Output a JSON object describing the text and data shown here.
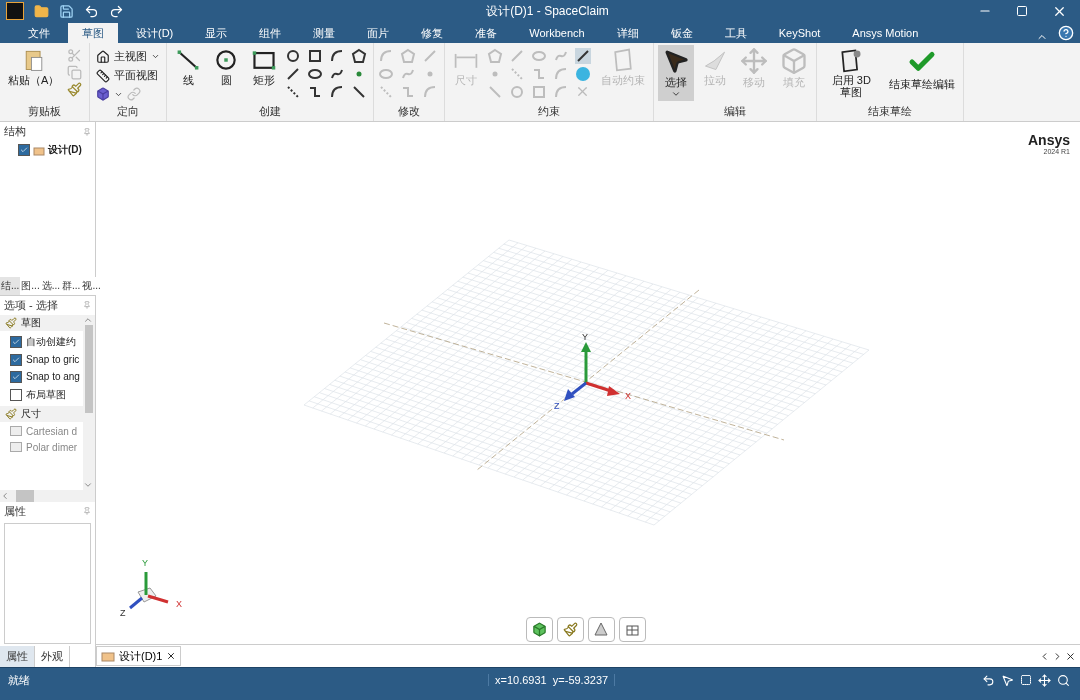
{
  "window": {
    "title": "设计(D)1 - SpaceClaim"
  },
  "ribbon_tabs": [
    {
      "label": "文件",
      "selected": false
    },
    {
      "label": "草图",
      "selected": true
    },
    {
      "label": "设计(D)",
      "selected": false
    },
    {
      "label": "显示",
      "selected": false
    },
    {
      "label": "组件",
      "selected": false
    },
    {
      "label": "测量",
      "selected": false
    },
    {
      "label": "面片",
      "selected": false
    },
    {
      "label": "修复",
      "selected": false
    },
    {
      "label": "准备",
      "selected": false
    },
    {
      "label": "Workbench",
      "selected": false
    },
    {
      "label": "详细",
      "selected": false
    },
    {
      "label": "钣金",
      "selected": false
    },
    {
      "label": "工具",
      "selected": false
    },
    {
      "label": "KeyShot",
      "selected": false
    },
    {
      "label": "Ansys Motion",
      "selected": false
    }
  ],
  "ribbon_groups": [
    {
      "kind": "clipboard",
      "label": "剪贴板",
      "buttons": [
        {
          "label": "粘贴（A）",
          "disabled": false
        }
      ]
    },
    {
      "kind": "orient",
      "label": "定向",
      "buttons": [
        {
          "label": "主视图"
        },
        {
          "label": "平面视图"
        }
      ]
    },
    {
      "kind": "create",
      "label": "创建",
      "buttons": [
        {
          "label": "线",
          "disabled": false
        },
        {
          "label": "圆",
          "disabled": false
        },
        {
          "label": "矩形",
          "disabled": false
        }
      ]
    },
    {
      "kind": "modify",
      "label": "修改"
    },
    {
      "kind": "constraint",
      "label": "约束",
      "buttons": [
        {
          "label": "尺寸",
          "disabled": true
        },
        {
          "label": "自动约束",
          "disabled": true
        }
      ]
    },
    {
      "kind": "edit",
      "label": "编辑",
      "buttons": [
        {
          "label": "选择",
          "disabled": false,
          "selected": true
        },
        {
          "label": "拉动",
          "disabled": true,
          "selected": false
        },
        {
          "label": "移动",
          "disabled": true,
          "selected": false
        },
        {
          "label": "填充",
          "disabled": true,
          "selected": false
        }
      ]
    },
    {
      "kind": "finish",
      "label": "结束草绘",
      "buttons": [
        {
          "label": "启用 3D 草图",
          "disabled": false
        },
        {
          "label": "结束草绘编辑",
          "disabled": false
        }
      ]
    }
  ],
  "structure_panel": {
    "title": "结构",
    "tree": [
      {
        "label": "设计(D)",
        "checked": true
      }
    ]
  },
  "panel_tabs": [
    {
      "label": "结...",
      "selected": true
    },
    {
      "label": "图...",
      "selected": false
    },
    {
      "label": "选...",
      "selected": false
    },
    {
      "label": "群...",
      "selected": false
    },
    {
      "label": "视...",
      "selected": false
    }
  ],
  "options_panel": {
    "title": "选项 - 选择",
    "items": [
      {
        "kind": "heading",
        "label": "草图"
      },
      {
        "kind": "checkbox",
        "label": "自动创建约",
        "checked": true
      },
      {
        "kind": "checkbox",
        "label": "Snap to gric",
        "checked": true
      },
      {
        "kind": "checkbox",
        "label": "Snap to ang",
        "checked": true
      },
      {
        "kind": "checkbox",
        "label": "布局草图",
        "checked": false
      },
      {
        "kind": "heading",
        "label": "尺寸"
      },
      {
        "kind": "option",
        "label": "Cartesian d"
      },
      {
        "kind": "option",
        "label": "Polar dimer"
      }
    ]
  },
  "properties_panel": {
    "title": "属性"
  },
  "bottom_tabs": [
    {
      "label": "属性",
      "selected": true
    },
    {
      "label": "外观",
      "selected": false
    }
  ],
  "viewport": {
    "logo": "Ansys",
    "version": "2024 R1",
    "axes": [
      "Y",
      "X",
      "Z"
    ],
    "triad": [
      "Y",
      "Z",
      "X"
    ]
  },
  "document_tabs": [
    {
      "label": "设计(D)1",
      "selected": true
    }
  ],
  "status_bar": {
    "message": "就绪",
    "coordinates": "x=10.6931  y=-59.3237"
  }
}
